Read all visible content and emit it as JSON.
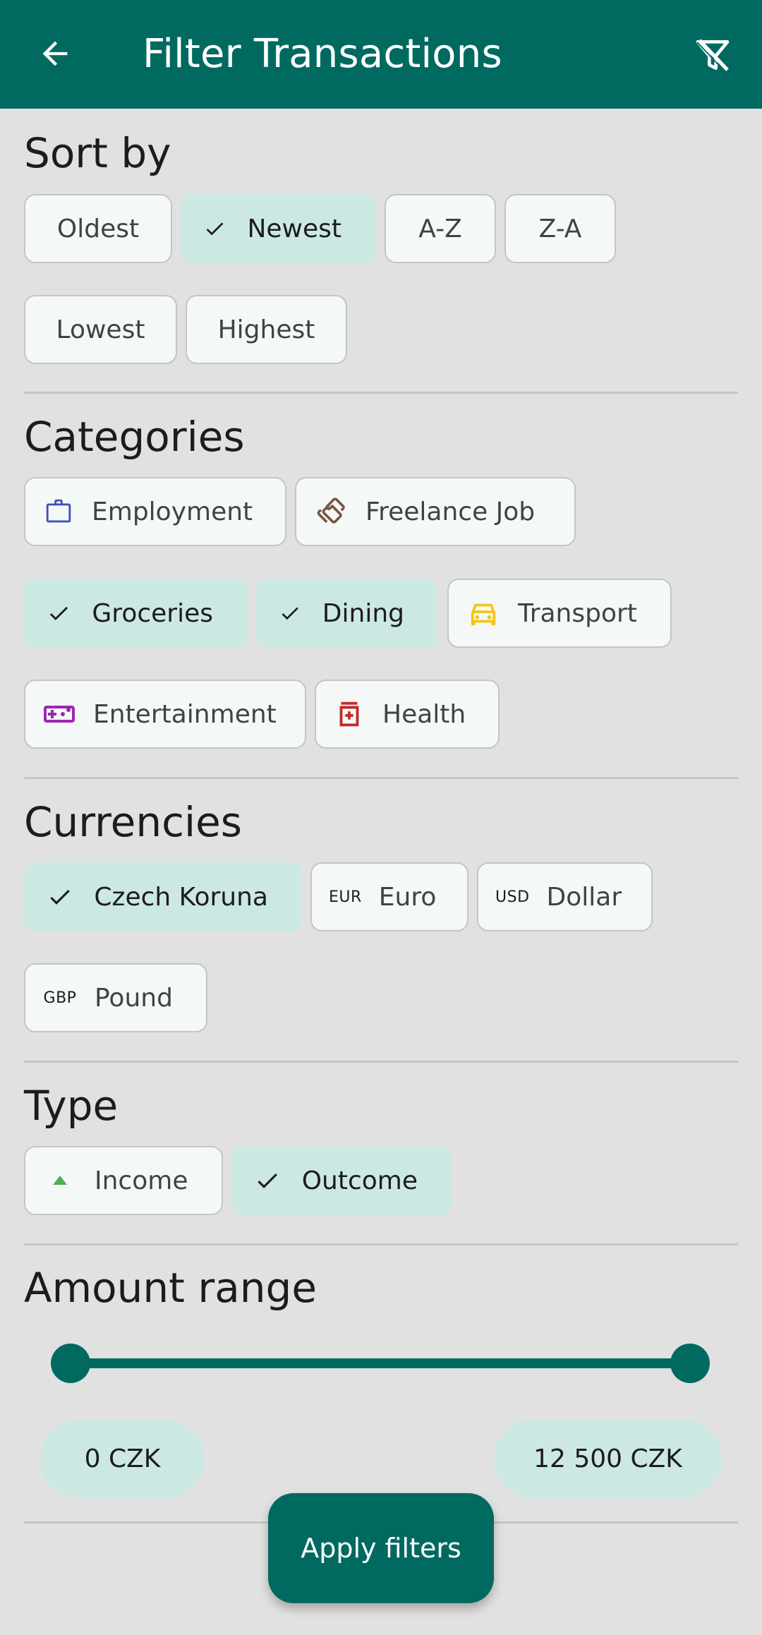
{
  "app_bar": {
    "title": "Filter Transactions",
    "back_icon": "arrow-back-icon",
    "clear_icon": "filter-off-icon"
  },
  "sort": {
    "title": "Sort by",
    "options": [
      "Oldest",
      "Newest",
      "A-Z",
      "Z-A",
      "Lowest",
      "Highest"
    ],
    "selected": "Newest"
  },
  "categories": {
    "title": "Categories",
    "items": [
      {
        "label": "Employment",
        "icon": "briefcase-icon",
        "color": "#3f51b5",
        "selected": false
      },
      {
        "label": "Freelance Job",
        "icon": "handshake-icon",
        "color": "#795548",
        "selected": false
      },
      {
        "label": "Groceries",
        "icon": "check-icon",
        "selected": true
      },
      {
        "label": "Dining",
        "icon": "check-icon",
        "selected": true
      },
      {
        "label": "Transport",
        "icon": "car-icon",
        "color": "#f5c518",
        "selected": false
      },
      {
        "label": "Entertainment",
        "icon": "gamepad-icon",
        "color": "#9c27b0",
        "selected": false
      },
      {
        "label": "Health",
        "icon": "medication-icon",
        "color": "#c62828",
        "selected": false
      }
    ]
  },
  "currencies": {
    "title": "Currencies",
    "items": [
      {
        "label": "Czech Koruna",
        "code": "",
        "selected": true
      },
      {
        "label": "Euro",
        "code": "EUR",
        "selected": false
      },
      {
        "label": "Dollar",
        "code": "USD",
        "selected": false
      },
      {
        "label": "Pound",
        "code": "GBP",
        "selected": false
      }
    ]
  },
  "type": {
    "title": "Type",
    "items": [
      {
        "label": "Income",
        "icon": "triangle-up-icon",
        "color": "#4caf50",
        "selected": false
      },
      {
        "label": "Outcome",
        "icon": "check-icon",
        "selected": true
      }
    ]
  },
  "amount_range": {
    "title": "Amount range",
    "min_label": "0 CZK",
    "max_label": "12 500 CZK",
    "range_fraction": [
      0,
      1
    ]
  },
  "apply_button": {
    "label": "Apply filters"
  },
  "colors": {
    "primary": "#006a60",
    "selected_chip": "#cce8e3",
    "background": "#e1e1e1"
  }
}
